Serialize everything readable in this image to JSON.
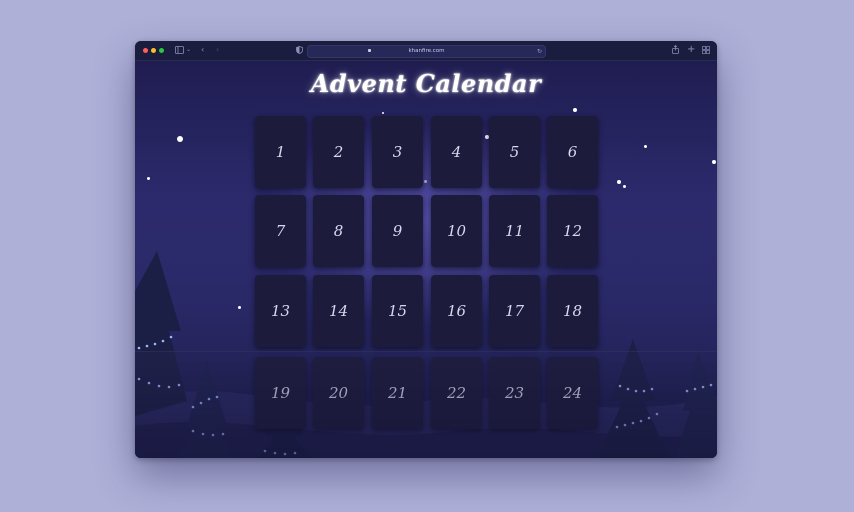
{
  "browser": {
    "url": "khanfire.com",
    "buttons": [
      "sidebar-toggle",
      "back",
      "forward",
      "privacy",
      "reload",
      "share",
      "new-tab",
      "tab-overview"
    ]
  },
  "page": {
    "title": "Advent Calendar",
    "days": [
      "1",
      "2",
      "3",
      "4",
      "5",
      "6",
      "7",
      "8",
      "9",
      "10",
      "11",
      "12",
      "13",
      "14",
      "15",
      "16",
      "17",
      "18",
      "19",
      "20",
      "21",
      "22",
      "23",
      "24"
    ]
  },
  "colors": {
    "background": "#aeb0d8",
    "sky_top": "#1f1d50",
    "sky_glow": "#7a6edc",
    "door": "#1d1b3b",
    "door_text": "#d9d8ee",
    "lights": "#9fb4ff"
  }
}
